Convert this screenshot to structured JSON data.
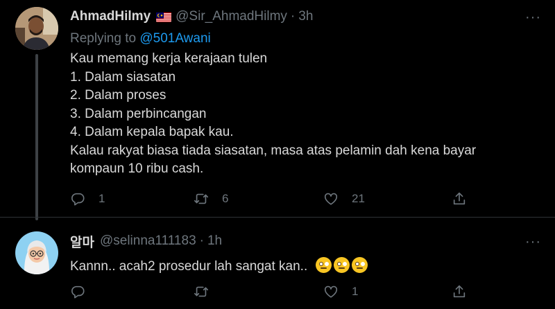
{
  "tweets": [
    {
      "name": "AhmadHilmy",
      "handle": "@Sir_AhmadHilmy",
      "separator": "·",
      "time": "3h",
      "replying_prefix": "Replying to",
      "replying_to": "@501Awani",
      "lines": [
        "Kau memang kerja kerajaan tulen",
        "1. Dalam siasatan",
        "2. Dalam proses",
        "3. Dalam perbincangan",
        "4. Dalam kepala bapak kau.",
        "Kalau rakyat biasa tiada siasatan, masa atas pelamin dah kena bayar",
        "kompaun 10 ribu cash."
      ],
      "reply_count": "1",
      "retweet_count": "6",
      "like_count": "21",
      "more": "···",
      "flag_icon": "malaysia-flag-icon"
    },
    {
      "name": "알마",
      "handle": "@selinna111183",
      "separator": "·",
      "time": "1h",
      "text": "Kannn.. acah2 prosedur lah sangat kan..",
      "emoji_icon": "face-with-rolling-eyes-icon",
      "reply_count": "",
      "retweet_count": "",
      "like_count": "1",
      "more": "···"
    }
  ],
  "colors": {
    "background": "#000000",
    "text": "#d9d9d9",
    "muted": "#6e767d",
    "link": "#1d9bf0",
    "divider": "#2f3336"
  }
}
